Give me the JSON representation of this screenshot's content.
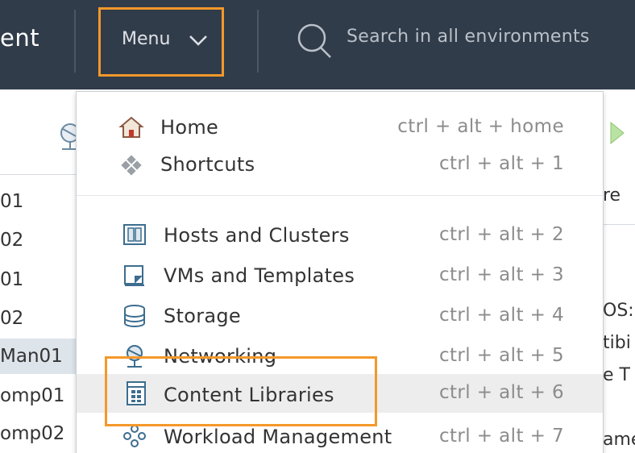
{
  "header": {
    "brand_fragment": "ent",
    "menu_label": "Menu",
    "search_placeholder": "Search in all environments"
  },
  "tree": {
    "items": [
      "01",
      "02",
      "01",
      "02",
      "Man01",
      "omp01",
      "omp02"
    ],
    "selected_index": 4
  },
  "right_panel": {
    "fragments": [
      "re",
      "OS:",
      "tibi",
      "e T",
      "ame"
    ]
  },
  "menu": {
    "items": [
      {
        "label": "Home",
        "shortcut": "ctrl + alt + home",
        "icon": "home-icon"
      },
      {
        "label": "Shortcuts",
        "shortcut": "ctrl + alt + 1",
        "icon": "shortcuts-icon"
      },
      {
        "label": "Hosts and Clusters",
        "shortcut": "ctrl + alt + 2",
        "icon": "hosts-clusters-icon"
      },
      {
        "label": "VMs and Templates",
        "shortcut": "ctrl + alt + 3",
        "icon": "vms-templates-icon"
      },
      {
        "label": "Storage",
        "shortcut": "ctrl + alt + 4",
        "icon": "storage-icon"
      },
      {
        "label": "Networking",
        "shortcut": "ctrl + alt + 5",
        "icon": "networking-icon"
      },
      {
        "label": "Content Libraries",
        "shortcut": "ctrl + alt + 6",
        "icon": "content-libraries-icon"
      },
      {
        "label": "Workload Management",
        "shortcut": "ctrl + alt + 7",
        "icon": "workload-management-icon"
      }
    ],
    "hovered_index": 6
  },
  "colors": {
    "header_bg": "#313c4a",
    "highlight": "#f4982a",
    "icon_blue": "#3d6d8f",
    "hover_bg": "#ededed"
  }
}
